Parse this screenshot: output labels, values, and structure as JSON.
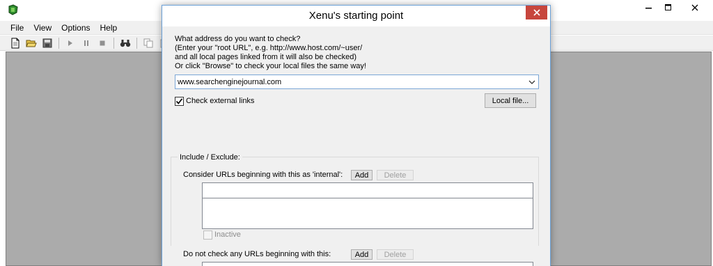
{
  "app": {
    "menu": [
      "File",
      "View",
      "Options",
      "Help"
    ],
    "toolbar_icons": [
      "new-file-icon",
      "open-folder-icon",
      "save-icon",
      "play-icon",
      "pause-icon",
      "stop-icon",
      "binoculars-icon",
      "copy-icon",
      "copy2-icon"
    ],
    "colors": {
      "workarea": "#ababab",
      "menubar": "#f0f0f0"
    }
  },
  "dialog": {
    "title": "Xenu's starting point",
    "instructions": [
      "What address do you want to check?",
      "(Enter your \"root URL\", e.g. http://www.host.com/~user/",
      "and all local pages linked from it will also be checked)",
      "Or click \"Browse\" to check your local files the same way!"
    ],
    "url_value": "www.searchenginejournal.com",
    "check_external_label": "Check external links",
    "check_external_checked": true,
    "local_file_button": "Local file...",
    "include_exclude": {
      "group_label": "Include / Exclude:",
      "internal_label": "Consider URLs beginning with this as 'internal':",
      "add_label": "Add",
      "delete_label": "Delete",
      "inactive_label": "Inactive",
      "do_not_check_label": "Do not check any URLs beginning with this:"
    },
    "colors": {
      "close_button": "#c7463d",
      "border": "#6aa0d8"
    }
  }
}
